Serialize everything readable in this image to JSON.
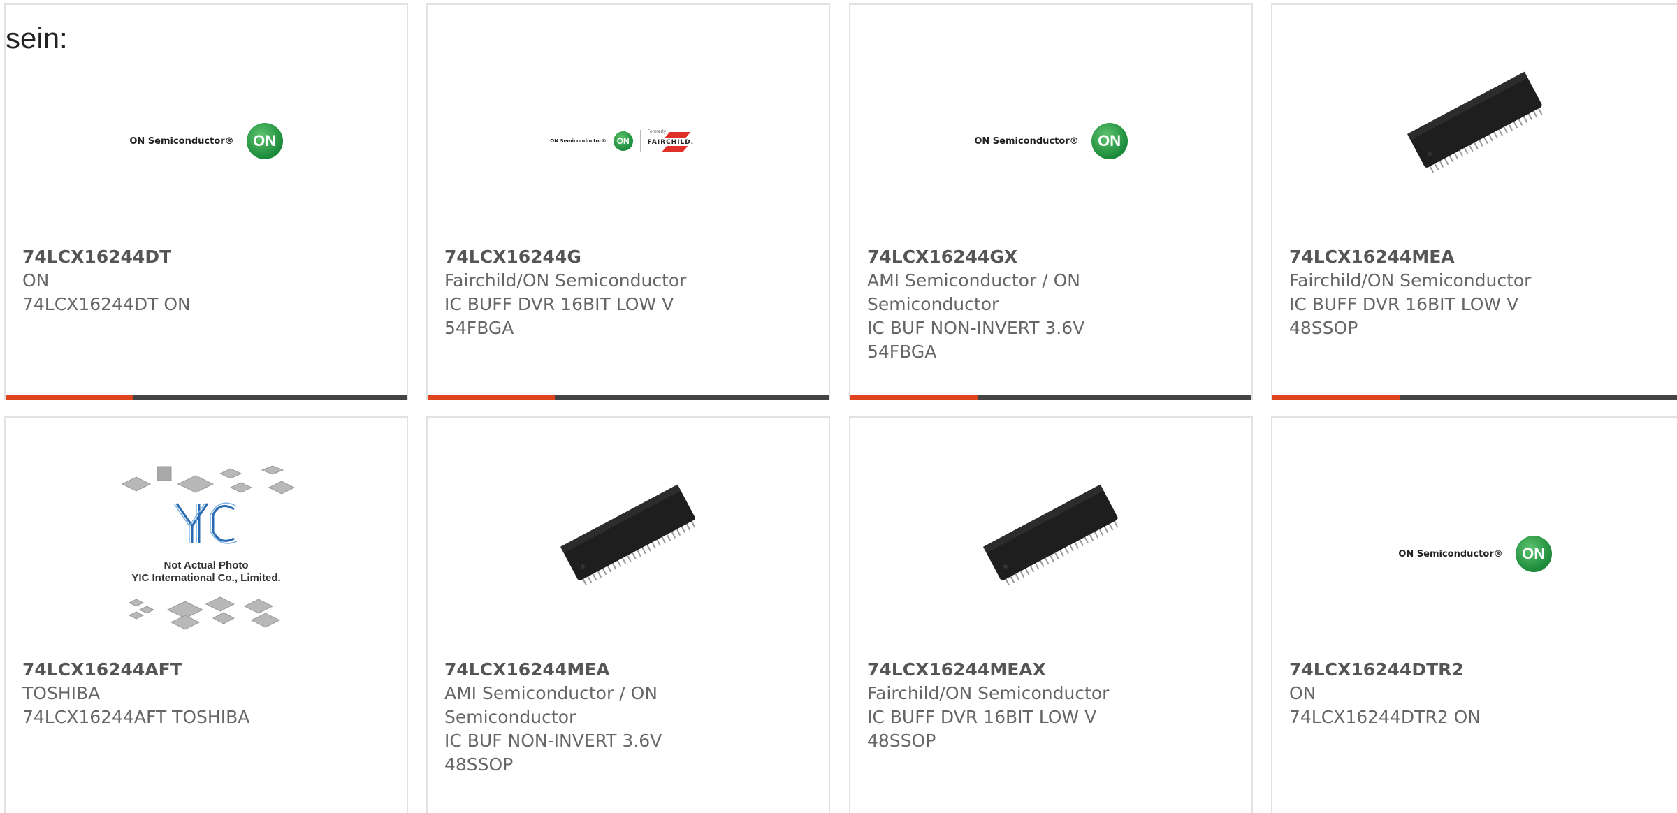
{
  "heading": "sein:",
  "yic_caption": [
    "Not Actual Photo",
    "YIC International Co., Limited."
  ],
  "logos": {
    "on_text": "ON Semiconductor®",
    "on_badge": "ON",
    "fairchild_formerly": "Formerly",
    "fairchild_text": "FAIRCHILD."
  },
  "colors": {
    "accent": "#e0441c",
    "bar": "#444444",
    "on_green": "#1a8a3a"
  },
  "products": [
    {
      "part": "74LCX16244DT",
      "manufacturer": "ON",
      "desc": [
        "74LCX16244DT ON"
      ],
      "image": "on-semiconductor-logo"
    },
    {
      "part": "74LCX16244G",
      "manufacturer": "Fairchild/ON Semiconductor",
      "desc": [
        "IC BUFF DVR 16BIT LOW V",
        "54FBGA"
      ],
      "image": "on-fairchild-logo"
    },
    {
      "part": "74LCX16244GX",
      "manufacturer": "AMI Semiconductor / ON Semiconductor",
      "desc": [
        "IC BUF NON-INVERT 3.6V",
        "54FBGA"
      ],
      "image": "on-semiconductor-logo"
    },
    {
      "part": "74LCX16244MEA",
      "manufacturer": "Fairchild/ON Semiconductor",
      "desc": [
        "IC BUFF DVR 16BIT LOW V",
        "48SSOP"
      ],
      "image": "ssop-chip-photo"
    },
    {
      "part": "74LCX16244AFT",
      "manufacturer": "TOSHIBA",
      "desc": [
        "74LCX16244AFT TOSHIBA"
      ],
      "image": "yic-placeholder"
    },
    {
      "part": "74LCX16244MEA",
      "manufacturer": "AMI Semiconductor / ON Semiconductor",
      "desc": [
        "IC BUF NON-INVERT 3.6V",
        "48SSOP"
      ],
      "image": "ssop-chip-photo"
    },
    {
      "part": "74LCX16244MEAX",
      "manufacturer": "Fairchild/ON Semiconductor",
      "desc": [
        "IC BUFF DVR 16BIT LOW V",
        "48SSOP"
      ],
      "image": "ssop-chip-photo"
    },
    {
      "part": "74LCX16244DTR2",
      "manufacturer": "ON",
      "desc": [
        "74LCX16244DTR2 ON"
      ],
      "image": "on-semiconductor-logo"
    }
  ]
}
